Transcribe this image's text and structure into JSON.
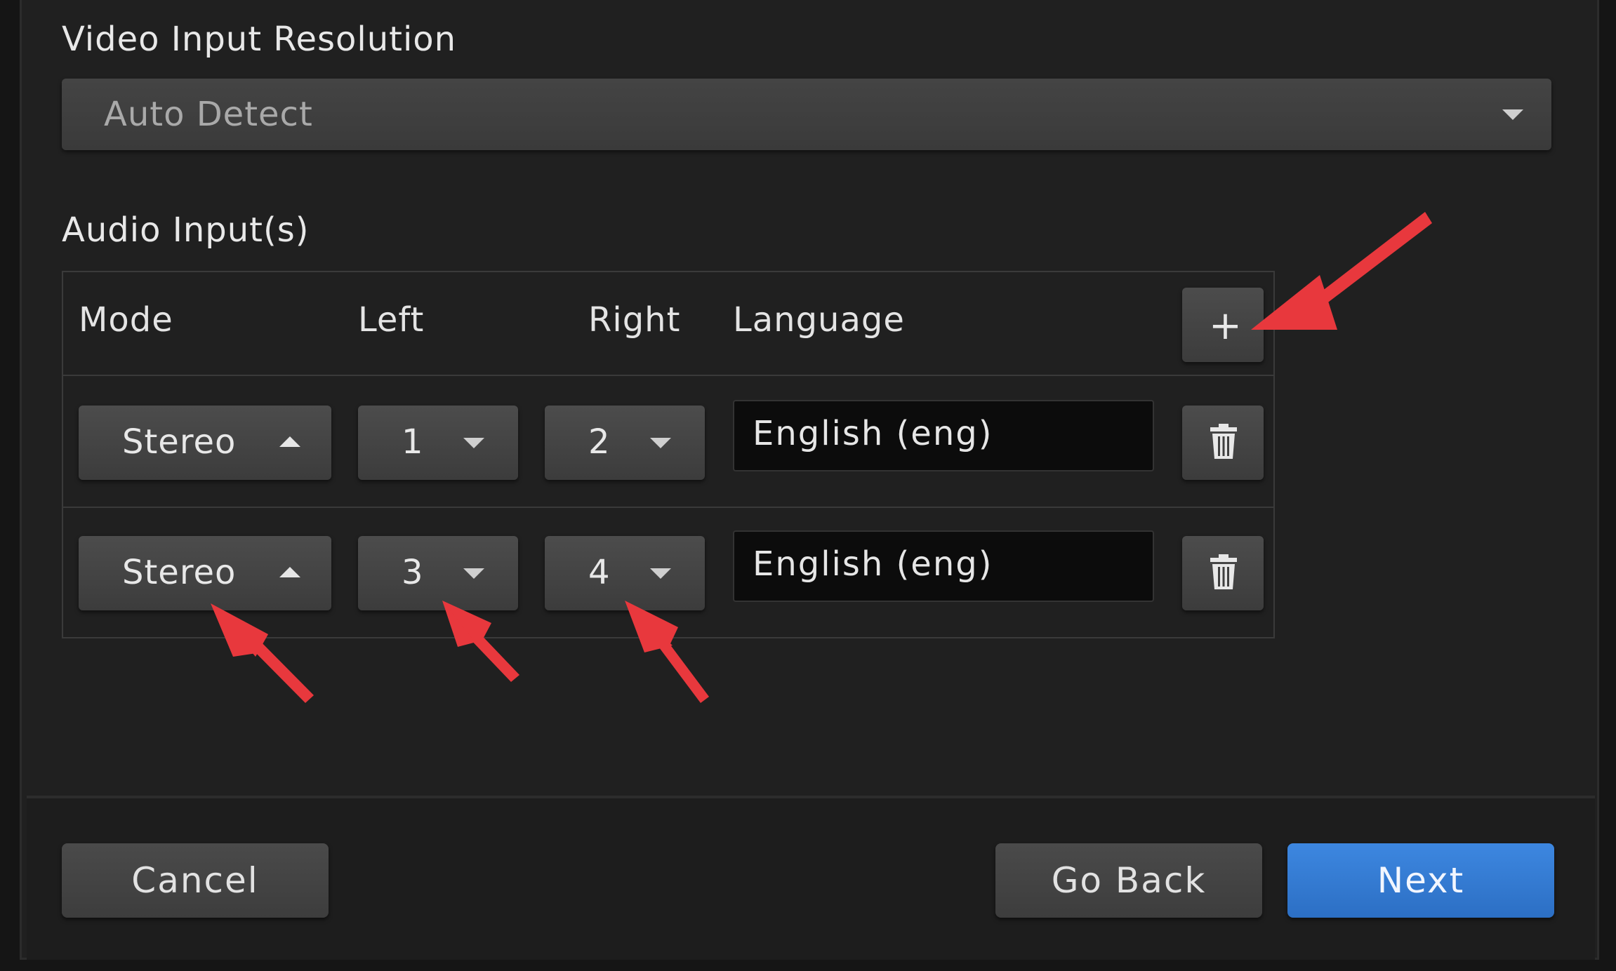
{
  "video": {
    "label": "Video Input Resolution",
    "resolution_value": "Auto Detect",
    "caret_icon": "chevron-down-icon"
  },
  "audio": {
    "label": "Audio Input(s)",
    "columns": [
      "Mode",
      "Left",
      "Right",
      "Language"
    ],
    "add_label": "+",
    "rows": [
      {
        "mode": "Stereo",
        "left": "1",
        "right": "2",
        "language": "English (eng)"
      },
      {
        "mode": "Stereo",
        "left": "3",
        "right": "4",
        "language": "English (eng)"
      }
    ]
  },
  "footer": {
    "cancel": "Cancel",
    "go_back": "Go Back",
    "next": "Next"
  },
  "colors": {
    "background": "#202020",
    "primary_button": "#3378d4",
    "annotation_arrow": "#e8383d"
  }
}
